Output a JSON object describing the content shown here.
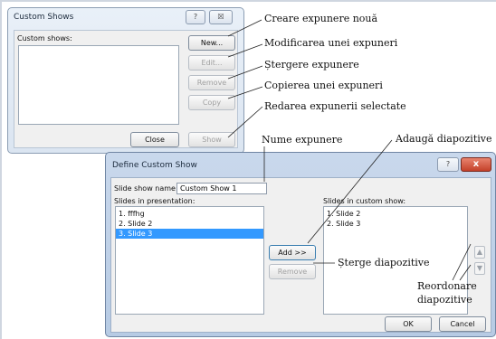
{
  "custom_shows_dialog": {
    "title": "Custom Shows",
    "help_label": "?",
    "close_label": "☒",
    "list_label": "Custom shows:",
    "buttons": {
      "new": "New...",
      "edit": "Edit...",
      "remove": "Remove",
      "copy": "Copy",
      "close": "Close",
      "show": "Show"
    }
  },
  "annotations_top": [
    "Creare expunere nouă",
    "Modificarea unei expuneri",
    "Ștergere expunere",
    "Copierea unei expuneri",
    "Redarea expunerii selectate"
  ],
  "annotations_bottom": {
    "name": "Nume expunere",
    "add": "Adaugă diapozitive",
    "delete": "Șterge diapozitive",
    "reorder_line1": "Reordonare",
    "reorder_line2": "diapozitive"
  },
  "define_dialog": {
    "title": "Define Custom Show",
    "help_label": "?",
    "close_label": "x",
    "name_label": "Slide show name:",
    "name_value": "Custom Show 1",
    "slides_label": "Slides in presentation:",
    "slides": [
      "1. fffhg",
      "2. Slide 2",
      "3. Slide 3"
    ],
    "custom_label": "Slides in custom show:",
    "custom_slides": [
      "1. Slide 2",
      "2. Slide 3"
    ],
    "add_label": "Add >>",
    "remove_label": "Remove",
    "up_label": "▲",
    "down_label": "▼",
    "ok_label": "OK",
    "cancel_label": "Cancel"
  }
}
